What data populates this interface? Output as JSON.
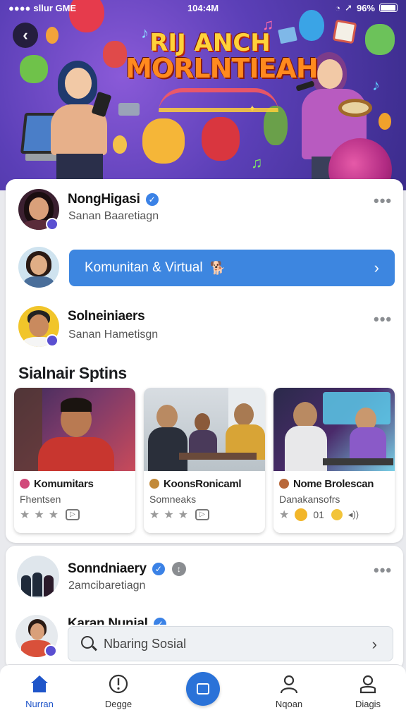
{
  "status_bar": {
    "carrier": "sllur GME",
    "time": "104:4M",
    "battery": "96%"
  },
  "hero": {
    "title_line1": "RIJ ANCH",
    "title_line2": "MORLNTIEAH"
  },
  "feed": [
    {
      "name": "NongHigasi",
      "subtitle": "Sanan Baaretiagn",
      "verified": true
    },
    {
      "pill_label": "Komunitan & Virtual",
      "pill_emoji": "🐕"
    },
    {
      "name": "Solneiniaers",
      "subtitle": "Sanan Hametisgn",
      "verified": false
    }
  ],
  "section": {
    "title": "Sialnair Sptins"
  },
  "tiles": [
    {
      "title": "Komumitars",
      "subtitle": "Fhentsen",
      "rating": "★★★",
      "emoji_color": "#d14a7a"
    },
    {
      "title": "KoonsRonicaml",
      "subtitle": "Somneaks",
      "rating": "★★★",
      "emoji_color": "#c28a3a"
    },
    {
      "title": "Nome Brolescan",
      "subtitle": "Danakansofrs",
      "rating": "★",
      "extra": "01",
      "emoji_color": "#b8683a"
    }
  ],
  "card2": {
    "name": "Sonndniaery",
    "subtitle": "2amcibaretiagn",
    "second_name": "Karan Nunial",
    "search_placeholder": "Nbaring Sosial"
  },
  "tabbar": [
    {
      "label": "Nurran",
      "icon": "home-icon",
      "active": true
    },
    {
      "label": "Degge",
      "icon": "info-icon",
      "active": false
    },
    {
      "label": "",
      "icon": "compose-icon",
      "active": false
    },
    {
      "label": "Nqoan",
      "icon": "person-icon",
      "active": false
    },
    {
      "label": "Diagis",
      "icon": "user-icon",
      "active": false
    }
  ],
  "colors": {
    "accent": "#3d86e0",
    "active_tab": "#1f55c9",
    "verified": "#3b82e6"
  }
}
